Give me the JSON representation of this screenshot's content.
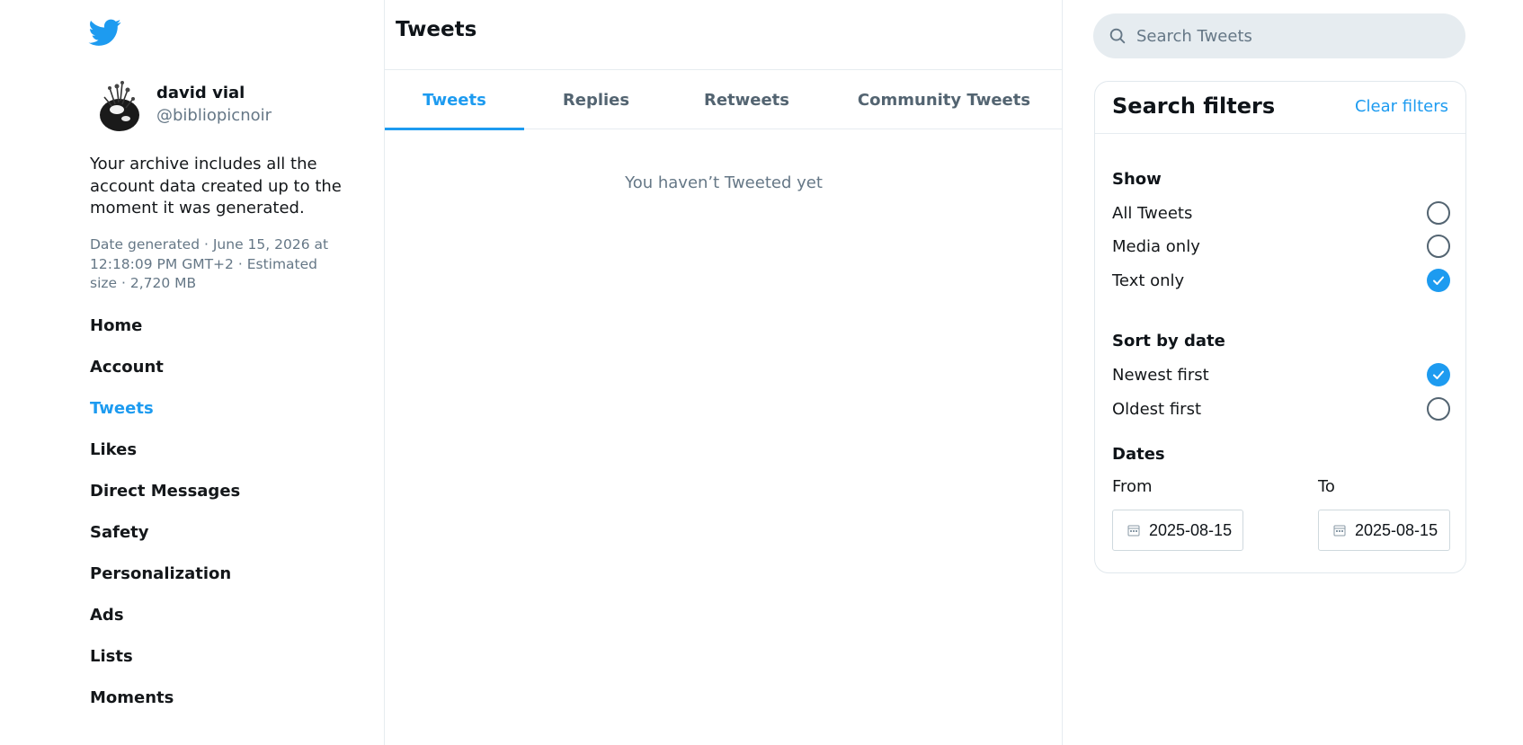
{
  "profile": {
    "display_name": "david vial",
    "handle": "@bibliopicnoir"
  },
  "archive": {
    "description": "Your archive includes all the account data created up to the moment it was generated.",
    "date_generated_label": "Date generated",
    "date_generated_value": "June 15, 2026 at 12:18:09 PM GMT+2",
    "estimated_size_label": "Estimated size",
    "estimated_size_value": "2,720 MB",
    "separator": "·"
  },
  "nav": {
    "items": [
      {
        "label": "Home"
      },
      {
        "label": "Account"
      },
      {
        "label": "Tweets"
      },
      {
        "label": "Likes"
      },
      {
        "label": "Direct Messages"
      },
      {
        "label": "Safety"
      },
      {
        "label": "Personalization"
      },
      {
        "label": "Ads"
      },
      {
        "label": "Lists"
      },
      {
        "label": "Moments"
      }
    ],
    "active": "Tweets"
  },
  "main": {
    "title": "Tweets",
    "tabs": [
      {
        "label": "Tweets"
      },
      {
        "label": "Replies"
      },
      {
        "label": "Retweets"
      },
      {
        "label": "Community Tweets"
      }
    ],
    "active_tab": "Tweets",
    "empty_message": "You haven’t Tweeted yet"
  },
  "search": {
    "placeholder": "Search Tweets",
    "value": ""
  },
  "filters": {
    "title": "Search filters",
    "clear_label": "Clear filters",
    "show": {
      "label": "Show",
      "options": [
        {
          "label": "All Tweets",
          "checked": false
        },
        {
          "label": "Media only",
          "checked": false
        },
        {
          "label": "Text only",
          "checked": true
        }
      ]
    },
    "sort": {
      "label": "Sort by date",
      "options": [
        {
          "label": "Newest first",
          "checked": true
        },
        {
          "label": "Oldest first",
          "checked": false
        }
      ]
    },
    "dates": {
      "label": "Dates",
      "from_label": "From",
      "to_label": "To",
      "from_value": "2025-08-15",
      "to_value": "2025-08-15"
    }
  },
  "colors": {
    "accent": "#1d9bf0",
    "muted_text": "#657786",
    "border": "#e6ecf0",
    "search_bg": "#e6ecf0"
  },
  "icons": {
    "logo": "twitter-bird-icon",
    "search": "search-icon",
    "calendar": "calendar-icon",
    "check": "check-icon"
  }
}
